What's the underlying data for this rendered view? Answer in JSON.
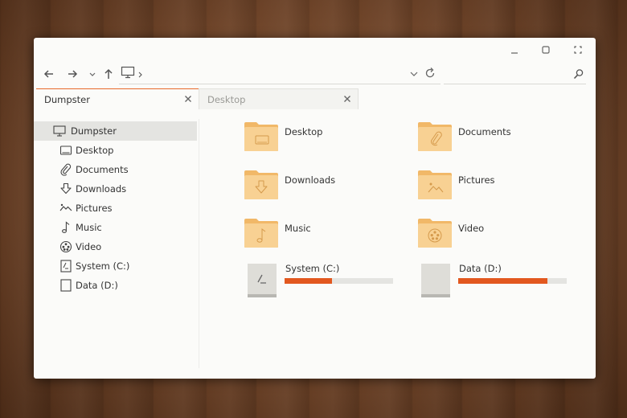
{
  "window_controls": [
    "minimize-icon",
    "maximize-icon",
    "close-icon"
  ],
  "toolbar": {
    "back": "arrow-left-icon",
    "forward": "arrow-right-icon",
    "history": "chevron-down-icon",
    "up": "arrow-up-icon",
    "location": "computer-icon",
    "reload": "reload-icon",
    "search": "search-icon"
  },
  "tabs": [
    {
      "label": "Dumpster",
      "active": true
    },
    {
      "label": "Desktop",
      "active": false
    }
  ],
  "sidebar": {
    "items": [
      {
        "label": "Dumpster",
        "icon": "computer-icon",
        "selected": true
      },
      {
        "label": "Desktop",
        "icon": "desktop-icon"
      },
      {
        "label": "Documents",
        "icon": "paperclip-icon"
      },
      {
        "label": "Downloads",
        "icon": "download-icon"
      },
      {
        "label": "Pictures",
        "icon": "pictures-icon"
      },
      {
        "label": "Music",
        "icon": "music-note-icon"
      },
      {
        "label": "Video",
        "icon": "film-reel-icon"
      },
      {
        "label": "System (C:)",
        "icon": "system-drive-icon"
      },
      {
        "label": "Data (D:)",
        "icon": "drive-icon"
      }
    ]
  },
  "folders": [
    {
      "label": "Desktop",
      "icon": "desktop-folder-icon"
    },
    {
      "label": "Documents",
      "icon": "documents-folder-icon"
    },
    {
      "label": "Downloads",
      "icon": "downloads-folder-icon"
    },
    {
      "label": "Pictures",
      "icon": "pictures-folder-icon"
    },
    {
      "label": "Music",
      "icon": "music-folder-icon"
    },
    {
      "label": "Video",
      "icon": "video-folder-icon"
    }
  ],
  "drives": [
    {
      "label": "System (C:)",
      "used_fraction": 0.44
    },
    {
      "label": "Data (D:)",
      "used_fraction": 0.82
    }
  ],
  "colors": {
    "accent": "#e2581f",
    "folder": "#f4c07a",
    "selected_row": "#e4e4e1"
  }
}
